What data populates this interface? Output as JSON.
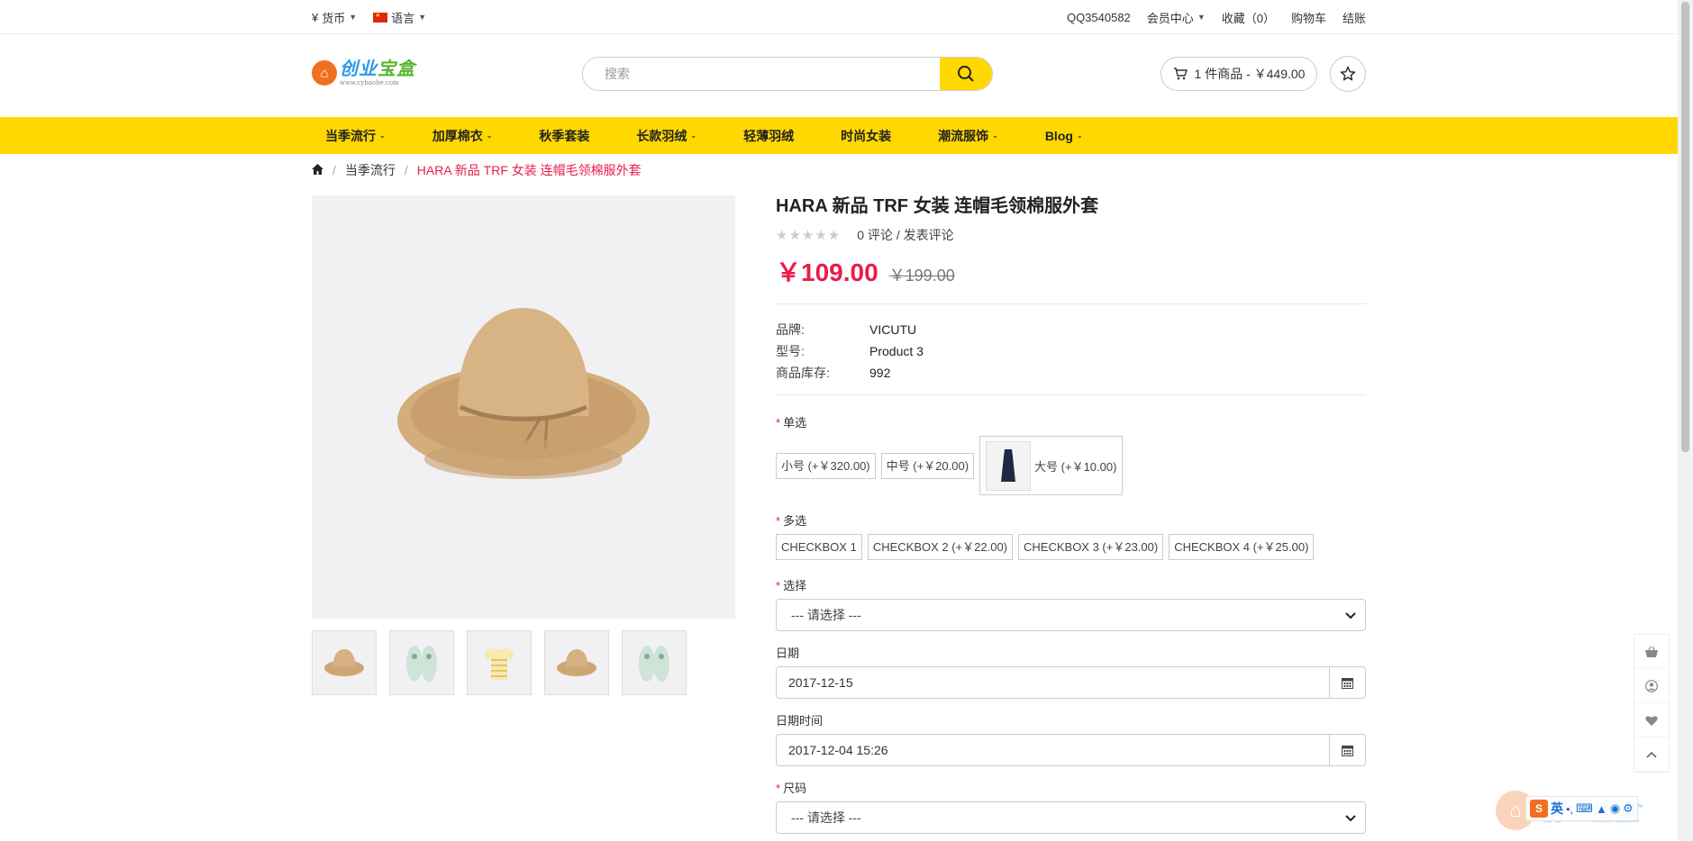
{
  "topbar": {
    "currency_symbol": "¥",
    "currency_label": "货币",
    "language_label": "语言",
    "qq": "QQ3540582",
    "account": "会员中心",
    "wishlist": "收藏（0）",
    "cart": "购物车",
    "checkout": "结账"
  },
  "header": {
    "logo_text_a": "创业",
    "logo_text_b": "宝盒",
    "logo_url": "www.cybaohe.com",
    "search_placeholder": "搜索",
    "cart_summary": "1 件商品 - ￥449.00"
  },
  "nav": {
    "items": [
      {
        "label": "当季流行",
        "dropdown": true
      },
      {
        "label": "加厚棉衣",
        "dropdown": true
      },
      {
        "label": "秋季套装",
        "dropdown": false
      },
      {
        "label": "长款羽绒",
        "dropdown": true
      },
      {
        "label": "轻薄羽绒",
        "dropdown": false
      },
      {
        "label": "时尚女装",
        "dropdown": false
      },
      {
        "label": "潮流服饰",
        "dropdown": true
      },
      {
        "label": "Blog",
        "dropdown": true
      }
    ]
  },
  "breadcrumb": {
    "category": "当季流行",
    "current": "HARA 新品 TRF 女装 连帽毛领棉服外套"
  },
  "product": {
    "title": "HARA 新品 TRF 女装 连帽毛领棉服外套",
    "stars": "★★★★★",
    "reviews": "0 评论",
    "write_review": "发表评论",
    "price": "￥109.00",
    "old_price": "￥199.00",
    "specs": [
      {
        "key": "品牌:",
        "value": "VICUTU"
      },
      {
        "key": "型号:",
        "value": "Product 3"
      },
      {
        "key": "商品库存:",
        "value": "992"
      }
    ],
    "thumbnails": [
      "hat",
      "slippers",
      "striped-shirt",
      "hat",
      "slippers"
    ]
  },
  "options": {
    "radio_label": "单选",
    "radio": [
      "小号 (+￥320.00)",
      "中号 (+￥20.00)",
      "大号 (+￥10.00)"
    ],
    "checkbox_label": "多选",
    "checkbox": [
      "CHECKBOX 1",
      "CHECKBOX 2 (+￥22.00)",
      "CHECKBOX 3 (+￥23.00)",
      "CHECKBOX 4 (+￥25.00)"
    ],
    "select_label": "选择",
    "select_value": "--- 请选择 ---",
    "date_label": "日期",
    "date_value": "2017-12-15",
    "datetime_label": "日期时间",
    "datetime_value": "2017-12-04 15:26",
    "size_label": "尺码",
    "size_value": "--- 请选择 ---"
  },
  "ime": {
    "s_label": "S",
    "lang": "英"
  },
  "colors": {
    "accent_yellow": "#ffd800",
    "price_red": "#e81d49",
    "logo_orange": "#f26f21",
    "logo_blue": "#2d9ae8"
  }
}
